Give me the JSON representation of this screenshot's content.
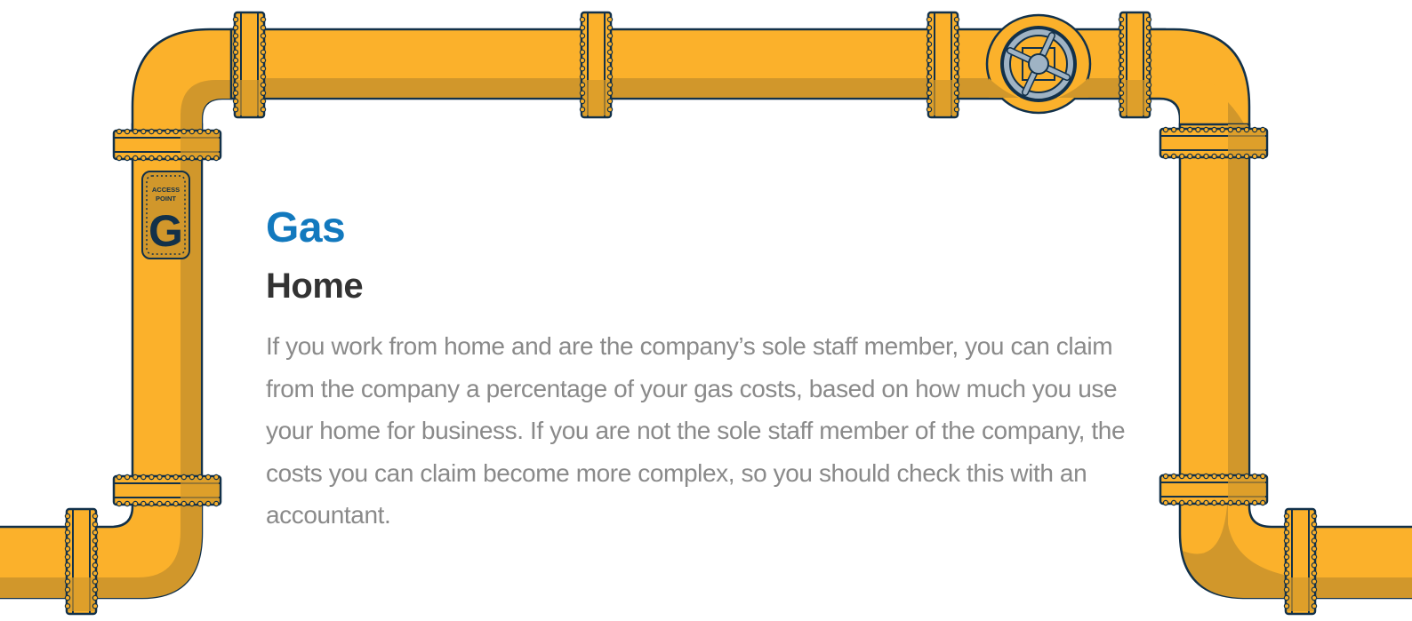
{
  "heading": "Gas",
  "subheading": "Home",
  "paragraph": "If you work from home and are the company’s sole staff member, you can claim from the company a percentage of your gas costs, based on how much you use your home for business. If you are not the sole staff member of the company, the costs you can claim become more complex, so you should check this with an accountant.",
  "access_plate": {
    "line1": "ACCESS",
    "line2": "POINT",
    "letter": "G"
  },
  "colors": {
    "pipe": "#fbb12b",
    "pipe_shadow": "#d1972b",
    "outline": "#12314a",
    "valve": "#9fb3c4",
    "title": "#1279be",
    "subtitle": "#333333",
    "body": "#8a8a8a"
  },
  "icons": [
    "valve-wheel-icon",
    "access-point-plate-icon"
  ]
}
